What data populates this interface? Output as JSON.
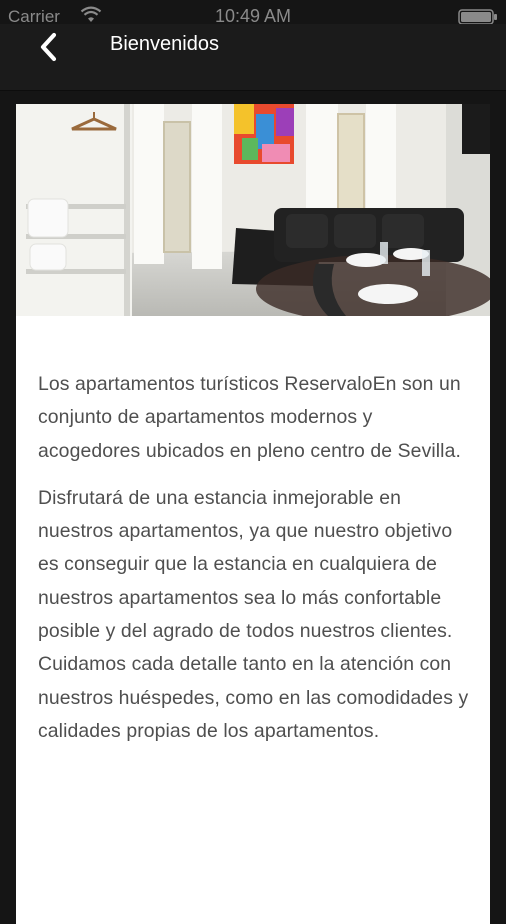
{
  "status_bar": {
    "carrier": "Carrier",
    "time": "10:49 AM",
    "wifi_icon": "wifi-icon",
    "battery_icon": "battery-icon"
  },
  "nav": {
    "title": "Bienvenidos",
    "back_icon": "chevron-left-icon"
  },
  "photo": {
    "subject": "apartment-living-room-photo"
  },
  "content": {
    "paragraphs": [
      "Los apartamentos turísticos ReservaloEn son un conjunto de apartamentos modernos y acogedores ubicados en pleno centro de Sevilla.",
      "Disfrutará de una estancia inmejorable en nuestros apartamentos, ya que nuestro objetivo es conseguir que la estancia en cualquiera de nuestros apartamentos sea lo más confortable posible y del agrado de todos nuestros clientes. Cuidamos cada detalle tanto en la atención con nuestros huéspedes, como en las comodidades y calidades propias de los apartamentos."
    ]
  },
  "colors": {
    "background": "#151515",
    "navbar": "#1b1b1b",
    "card": "#ffffff",
    "text": "#4f4f4f",
    "title": "#ffffff"
  }
}
